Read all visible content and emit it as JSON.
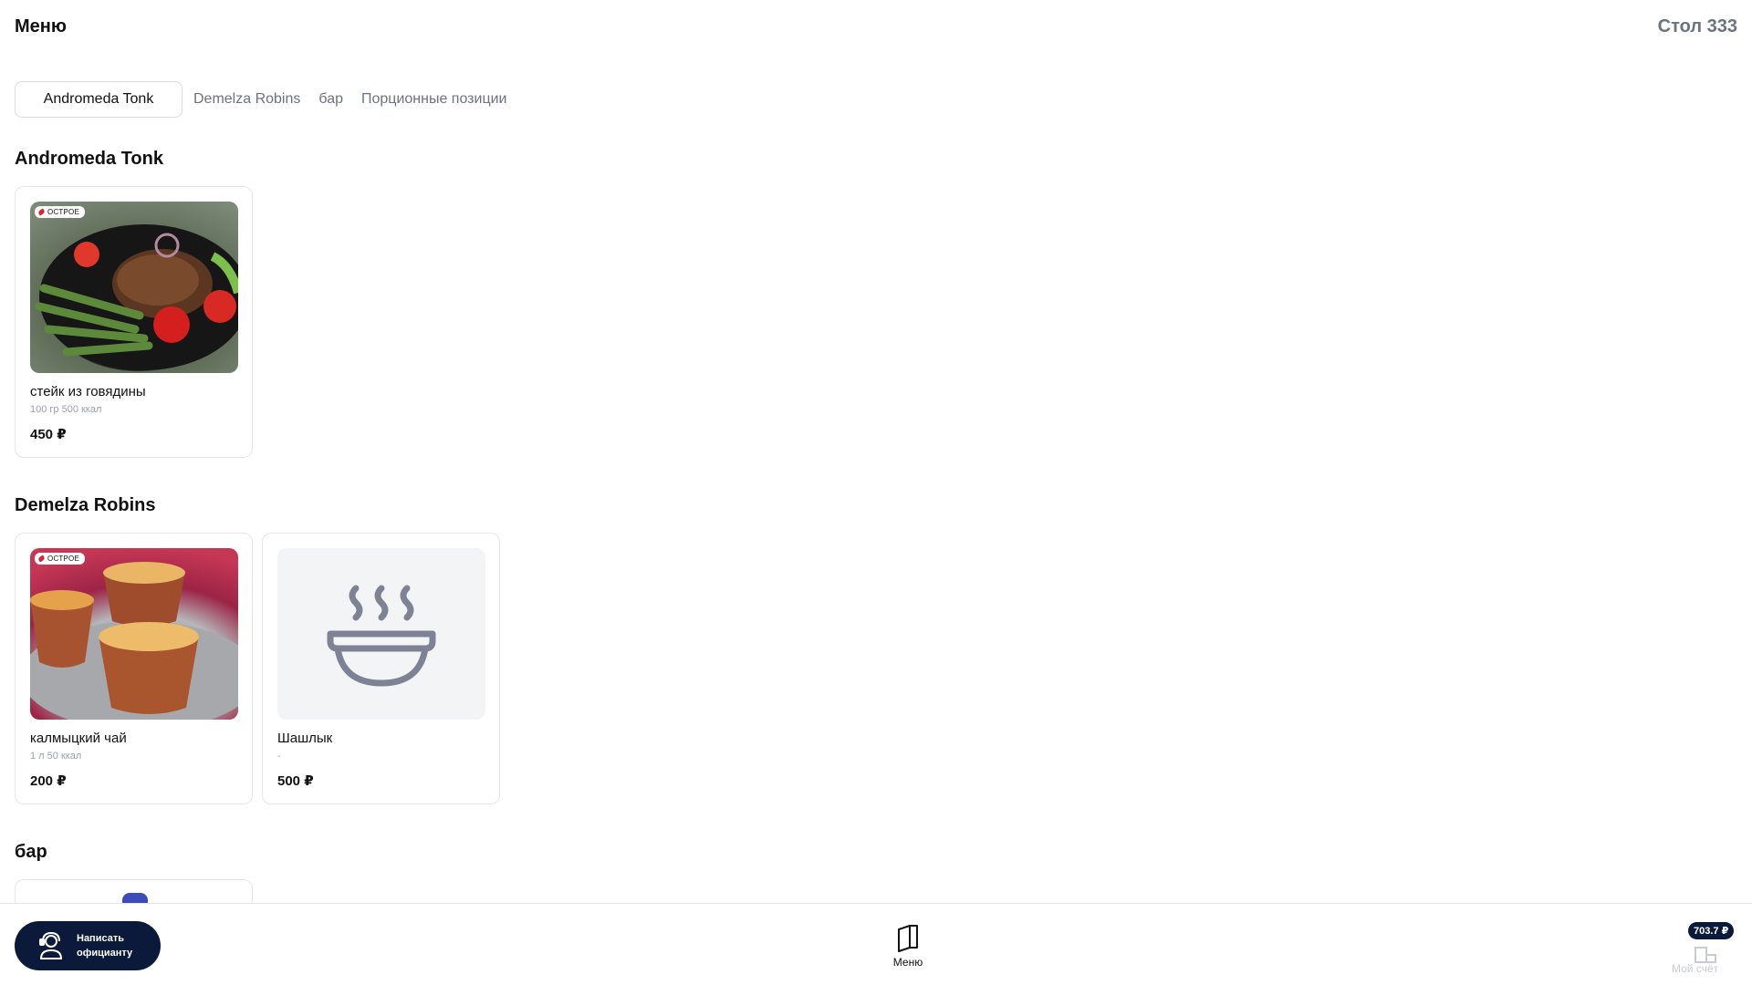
{
  "header": {
    "title": "Меню",
    "table": "Стол 333"
  },
  "tabs": [
    {
      "label": "Andromeda Tonk",
      "active": true
    },
    {
      "label": "Demelza Robins",
      "active": false
    },
    {
      "label": "бар",
      "active": false
    },
    {
      "label": "Порционные позиции",
      "active": false
    }
  ],
  "sections": [
    {
      "title": "Andromeda Tonk",
      "items": [
        {
          "name": "стейк из говядины",
          "meta": "100 гр 500 ккал",
          "price": "450 ₽",
          "badge": "ОСТРОЕ",
          "image": "steak-photo"
        }
      ]
    },
    {
      "title": "Demelza Robins",
      "items": [
        {
          "name": "калмыцкий чай",
          "meta": "1 л 50 ккал",
          "price": "200 ₽",
          "badge": "ОСТРОЕ",
          "image": "tea-photo"
        },
        {
          "name": "Шашлык",
          "meta": "-",
          "price": "500 ₽",
          "badge": "",
          "image": "bowl-placeholder-icon"
        }
      ]
    },
    {
      "title": "бар",
      "items": []
    }
  ],
  "bottom": {
    "waiter_line1": "Написать",
    "waiter_line2": "официанту",
    "menu_label": "Меню",
    "bill_label": "Мой счёт",
    "bill_amount": "703.7 ₽"
  },
  "colors": {
    "accent": "#0b1a3a",
    "muted": "#6b7280",
    "border": "#e3e6ea"
  }
}
